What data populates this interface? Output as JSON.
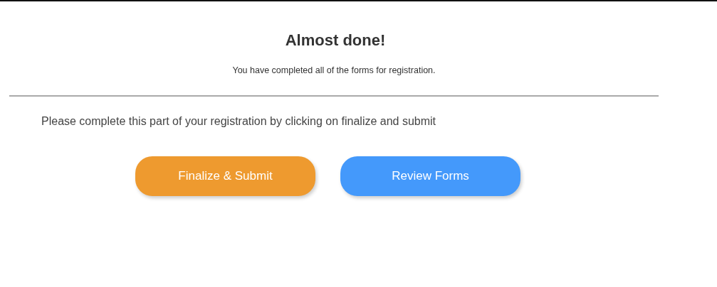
{
  "heading": "Almost done!",
  "subtitle": "You have completed all of the forms for registration.",
  "instruction": "Please complete this part of your registration by clicking on finalize and submit",
  "buttons": [
    {
      "label": "Finalize & Submit",
      "kind": "primary"
    },
    {
      "label": "Review Forms",
      "kind": "secondary"
    }
  ]
}
